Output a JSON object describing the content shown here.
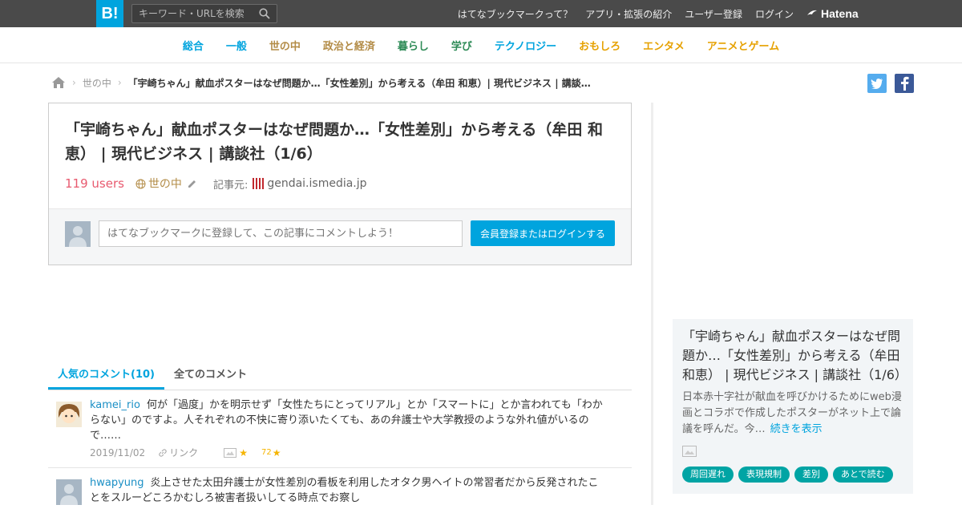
{
  "header": {
    "logo": "B!",
    "search_placeholder": "キーワード・URLを検索",
    "links": [
      "はてなブックマークって？",
      "アプリ・拡張の紹介",
      "ユーザー登録",
      "ログイン"
    ],
    "brand": "Hatena"
  },
  "nav": {
    "items": [
      {
        "label": "総合",
        "color": "#00a4de"
      },
      {
        "label": "一般",
        "color": "#00a4de"
      },
      {
        "label": "世の中",
        "color": "#b38c47"
      },
      {
        "label": "政治と経済",
        "color": "#b38c47"
      },
      {
        "label": "暮らし",
        "color": "#2e8b57"
      },
      {
        "label": "学び",
        "color": "#2e8b57"
      },
      {
        "label": "テクノロジー",
        "color": "#00a4de"
      },
      {
        "label": "おもしろ",
        "color": "#e6a100"
      },
      {
        "label": "エンタメ",
        "color": "#e6a100"
      },
      {
        "label": "アニメとゲーム",
        "color": "#e6a100"
      }
    ]
  },
  "breadcrumb": {
    "category": "世の中",
    "current": "「宇崎ちゃん」献血ポスターはなぜ問題か…「女性差別」から考える（牟田 和恵）| 現代ビジネス | 講談社…"
  },
  "entry": {
    "title": "「宇崎ちゃん」献血ポスターはなぜ問題か…「女性差別」から考える（牟田 和恵） | 現代ビジネス | 講談社（1/6）",
    "users": "119 users",
    "category": "世の中",
    "source_label": "記事元:",
    "source": "gendai.ismedia.jp",
    "comment_placeholder": "はてなブックマークに登録して、この記事にコメントしよう！",
    "login_button": "会員登録またはログインする"
  },
  "tabs": {
    "popular": "人気のコメント(10)",
    "all": "全てのコメント"
  },
  "comments": [
    {
      "user": "kamei_rio",
      "text": "何が「過度」かを明示せず「女性たちにとってリアル」とか「スマートに」とか言われても「わからない」のですよ。人それぞれの不快に寄り添いたくても、あの弁護士や大学教授のような外れ値がいるので……",
      "date": "2019/11/02",
      "link_label": "リンク",
      "star_count": "72"
    },
    {
      "user": "hwapyung",
      "text": "炎上させた太田弁護士が女性差別の看板を利用したオタク男ヘイトの常習者だから反発されたことをスルーどころかむしろ被害者扱いしてる時点でお察し"
    }
  ],
  "sidebar": {
    "title": "「宇崎ちゃん」献血ポスターはなぜ問題か…「女性差別」から考える（牟田 和恵） | 現代ビジネス | 講談社（1/6）",
    "description": "日本赤十字社が献血を呼びかけるためにweb漫画とコラボで作成したポスターがネット上で論議を呼んだ。今…",
    "more": "続きを表示",
    "tags": [
      "周回遅れ",
      "表現規制",
      "差別",
      "あとで読む"
    ]
  }
}
